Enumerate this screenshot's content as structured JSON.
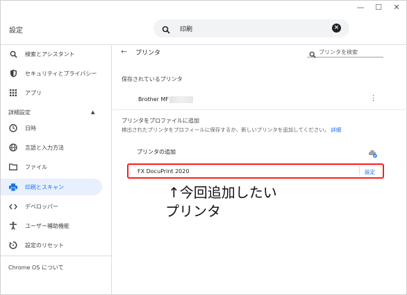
{
  "window": {
    "minimize": "—",
    "maximize": "☐",
    "close": "✕"
  },
  "header": {
    "title": "設定",
    "search_value": "印刷"
  },
  "sidebar": {
    "items": [
      {
        "label": "検索とアシスタント",
        "icon": "search-icon"
      },
      {
        "label": "セキュリティとプライバシー",
        "icon": "shield-icon"
      },
      {
        "label": "アプリ",
        "icon": "apps-grid-icon"
      }
    ],
    "advanced_header": "詳細設定",
    "advanced_items": [
      {
        "label": "日時",
        "icon": "clock-icon"
      },
      {
        "label": "言語と入力方法",
        "icon": "globe-icon"
      },
      {
        "label": "ファイル",
        "icon": "folder-icon"
      },
      {
        "label": "印刷とスキャン",
        "icon": "printer-icon",
        "active": true
      },
      {
        "label": "デベロッパー",
        "icon": "code-icon"
      },
      {
        "label": "ユーザー補助機能",
        "icon": "accessibility-icon"
      },
      {
        "label": "設定のリセット",
        "icon": "reset-icon"
      }
    ],
    "about": "Chrome OS について"
  },
  "main": {
    "title": "プリンタ",
    "search_placeholder": "プリンタを検索",
    "saved_title": "保存されているプリンタ",
    "saved_printer": "Brother MF",
    "add_profile_title": "プリンタをプロファイルに追加",
    "add_profile_desc": "検出されたプリンタをプロフィールに保存するか、新しいプリンタを追加してください。",
    "details_link": "詳細",
    "add_printer_title": "プリンタの追加",
    "found_printer": "FX DocuPrint 2020",
    "setup_label": "設定"
  },
  "annotation": {
    "line1": "↑今回追加したい",
    "line2": "プリンタ"
  },
  "colors": {
    "accent": "#1a73e8",
    "active_bg": "#e8f0fe",
    "highlight": "#ff1a1a"
  }
}
